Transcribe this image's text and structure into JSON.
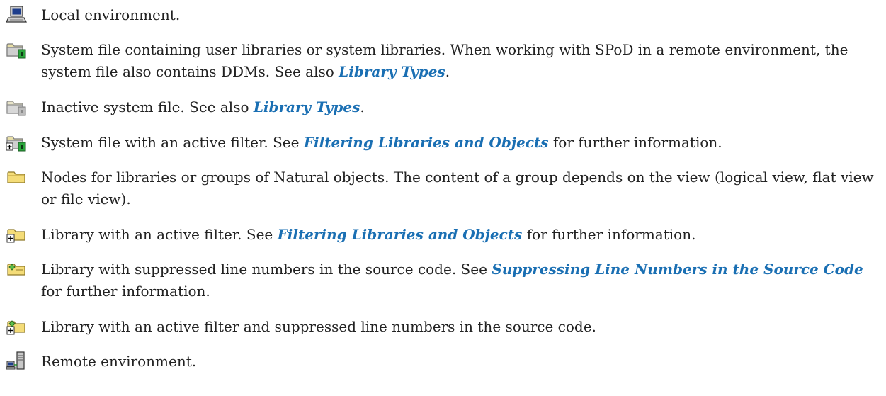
{
  "items": [
    {
      "icon": "local-environment-icon",
      "pre": "Local environment.",
      "link": "",
      "post": ""
    },
    {
      "icon": "system-file-icon",
      "pre": "System file containing user libraries or system libraries. When working with SPoD in a remote environment, the system file also contains DDMs. See also ",
      "link": "Library Types",
      "post": "."
    },
    {
      "icon": "inactive-system-file-icon",
      "pre": "Inactive system file. See also ",
      "link": "Library Types",
      "post": "."
    },
    {
      "icon": "system-file-active-filter-icon",
      "pre": "System file with an active filter. See ",
      "link": "Filtering Libraries and Objects",
      "post": " for further information."
    },
    {
      "icon": "library-node-icon",
      "pre": "Nodes for libraries or groups of Natural objects. The content of a group depends on the view (logical view, flat view or file view).",
      "link": "",
      "post": ""
    },
    {
      "icon": "library-active-filter-icon",
      "pre": "Library with an active filter. See ",
      "link": "Filtering Libraries and Objects",
      "post": " for further information."
    },
    {
      "icon": "library-suppressed-line-numbers-icon",
      "pre": "Library with suppressed line numbers in the source code. See ",
      "link": "Suppressing Line Numbers in the Source Code",
      "post": " for further information."
    },
    {
      "icon": "library-filter-suppressed-line-numbers-icon",
      "pre": "Library with an active filter and suppressed line numbers in the source code.",
      "link": "",
      "post": ""
    },
    {
      "icon": "remote-environment-icon",
      "pre": "Remote environment.",
      "link": "",
      "post": ""
    }
  ]
}
